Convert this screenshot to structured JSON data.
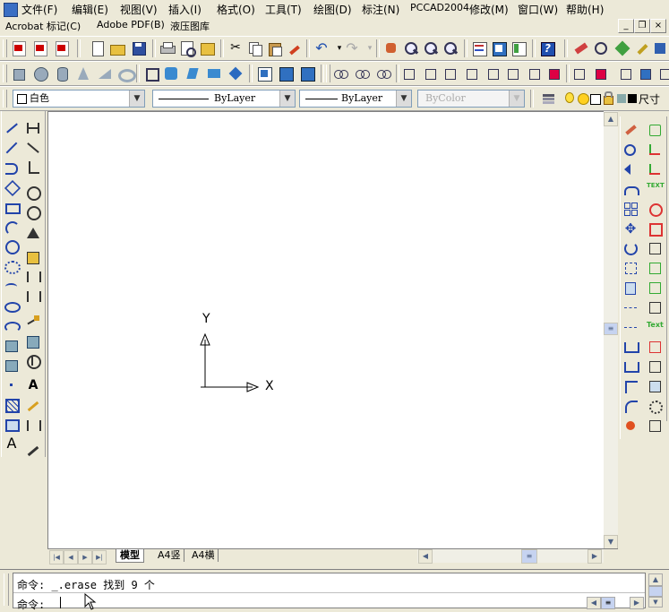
{
  "menu": {
    "items": [
      "文件(F)",
      "编辑(E)",
      "视图(V)",
      "插入(I)",
      "格式(O)",
      "工具(T)",
      "绘图(D)",
      "标注(N)",
      "PCCAD2004",
      "修改(M)",
      "窗口(W)",
      "帮助(H)"
    ],
    "row2": [
      "Acrobat 标记(C)",
      "Adobe PDF(B)",
      "液压图库"
    ]
  },
  "window_controls": {
    "minimize": "_",
    "restore": "❐",
    "close": "×"
  },
  "properties": {
    "layer": "白色",
    "linetype": "ByLayer",
    "lineweight": "ByLayer",
    "color": "ByColor",
    "layer_dim": "尺寸"
  },
  "canvas": {
    "axis_x": "X",
    "axis_y": "Y"
  },
  "tabs": {
    "nav": [
      "|◀",
      "◀",
      "▶",
      "▶|"
    ],
    "items": [
      "模型",
      "A4竖",
      "A4横"
    ],
    "active": "模型"
  },
  "command": {
    "history": "命令: _.erase 找到 9 个",
    "prompt": "命令:"
  },
  "colors": {
    "ucs_icon": "#000000",
    "canvas": "#ffffff",
    "chrome": "#ece9d8"
  }
}
